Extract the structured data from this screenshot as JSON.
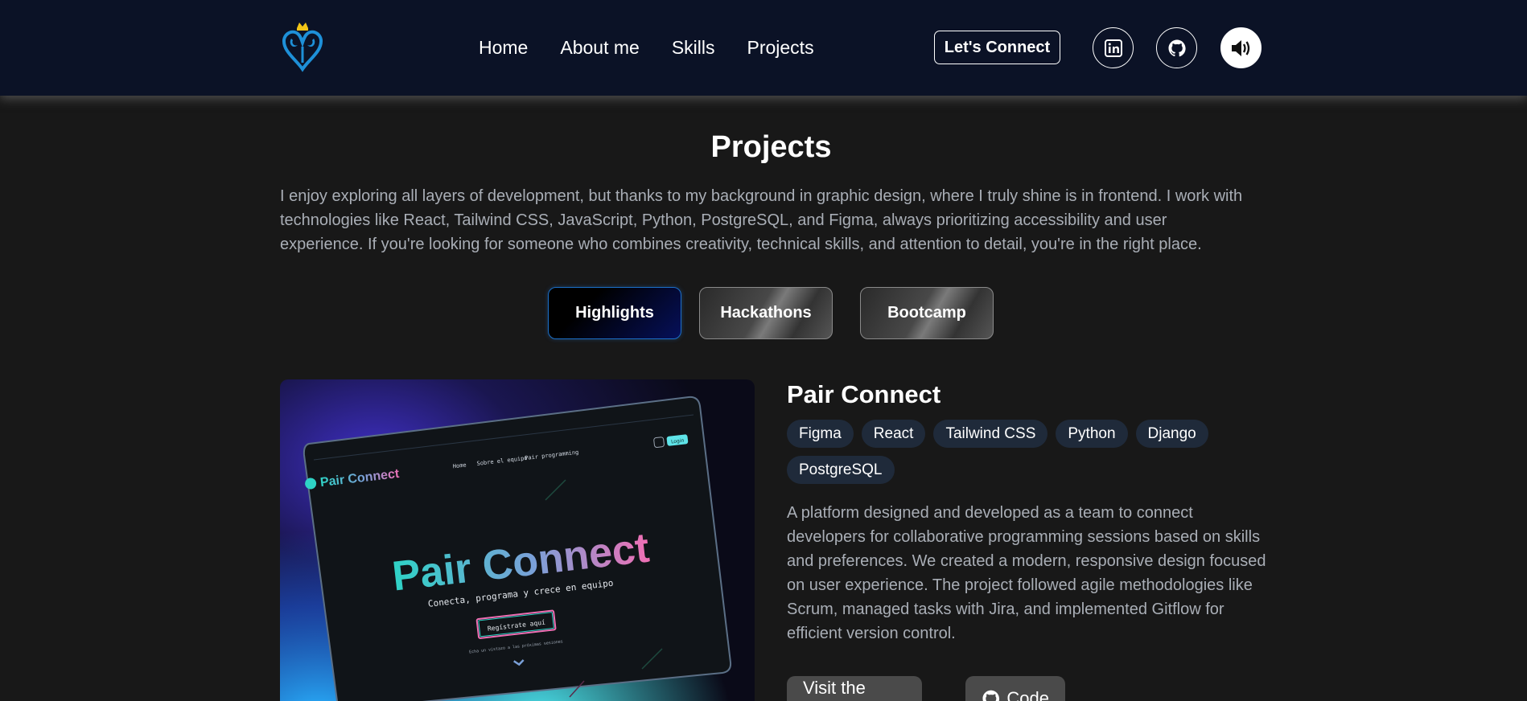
{
  "nav": {
    "links": [
      "Home",
      "About me",
      "Skills",
      "Projects"
    ],
    "connect_label": "Let's Connect",
    "icons": [
      "kingdom-hearts-logo-icon",
      "linkedin-icon",
      "github-icon",
      "speaker-icon"
    ]
  },
  "section": {
    "title": "Projects",
    "intro": "I enjoy exploring all layers of development, but thanks to my background in graphic design, where I truly shine is in frontend. I work with technologies like React, Tailwind CSS, JavaScript, Python, PostgreSQL, and Figma, always prioritizing accessibility and user experience. If you're looking for someone who combines creativity, technical skills, and attention to detail, you're in the right place."
  },
  "tabs": [
    "Highlights",
    "Hackathons",
    "Bootcamp"
  ],
  "project": {
    "title": "Pair Connect",
    "tags": [
      "Figma",
      "React",
      "Tailwind CSS",
      "Python",
      "Django",
      "PostgreSQL"
    ],
    "description": "A platform designed and developed as a team to connect developers for collaborative programming sessions based on skills and preferences. We created a modern, responsive design focused on user experience. The project followed agile methodologies like Scrum, managed tasks with Jira, and implemented Gitflow for efficient version control.",
    "visit_label": "Visit the website",
    "code_label": "Code",
    "mockup": {
      "logo_text": "Pair Connect",
      "nav_items": [
        "Home",
        "Sobre el equipo",
        "Pair programming"
      ],
      "login_label": "Login",
      "hero_title": "Pair Connect",
      "hero_subtitle": "Conecta, programa y crece en equipo",
      "cta_label": "Regístrate aquí",
      "small_text": "Echa un vistazo a las próximas sesiones"
    }
  },
  "colors": {
    "navbar_bg": "#0b1226",
    "page_bg": "#181818",
    "tag_bg": "#1f2a3a",
    "accent_blue": "#1b6fc7"
  }
}
